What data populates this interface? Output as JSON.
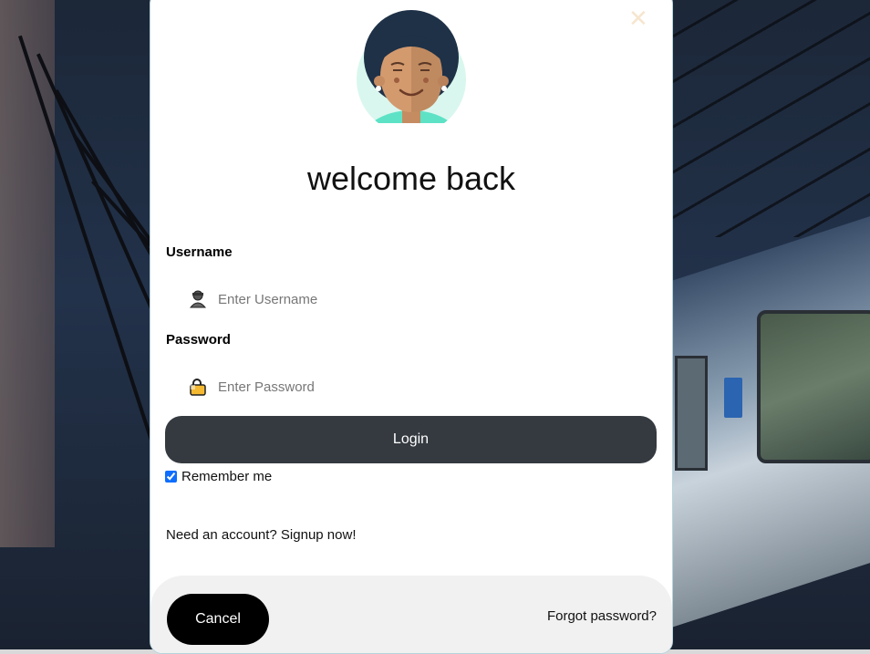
{
  "modal": {
    "title": "welcome back",
    "close_icon": "close-icon"
  },
  "form": {
    "username_label": "Username",
    "username_placeholder": "Enter Username",
    "password_label": "Password",
    "password_placeholder": "Enter Password",
    "login_label": "Login",
    "remember_label": "Remember me",
    "remember_checked": true,
    "signup_text": "Need an account? Signup now!"
  },
  "footer": {
    "cancel_label": "Cancel",
    "forgot_label": "Forgot password?"
  },
  "colors": {
    "login_button": "#343a40",
    "cancel_button": "#000000",
    "footer_bg": "#f1f1f1",
    "avatar_bg": "#d9f7ee"
  }
}
